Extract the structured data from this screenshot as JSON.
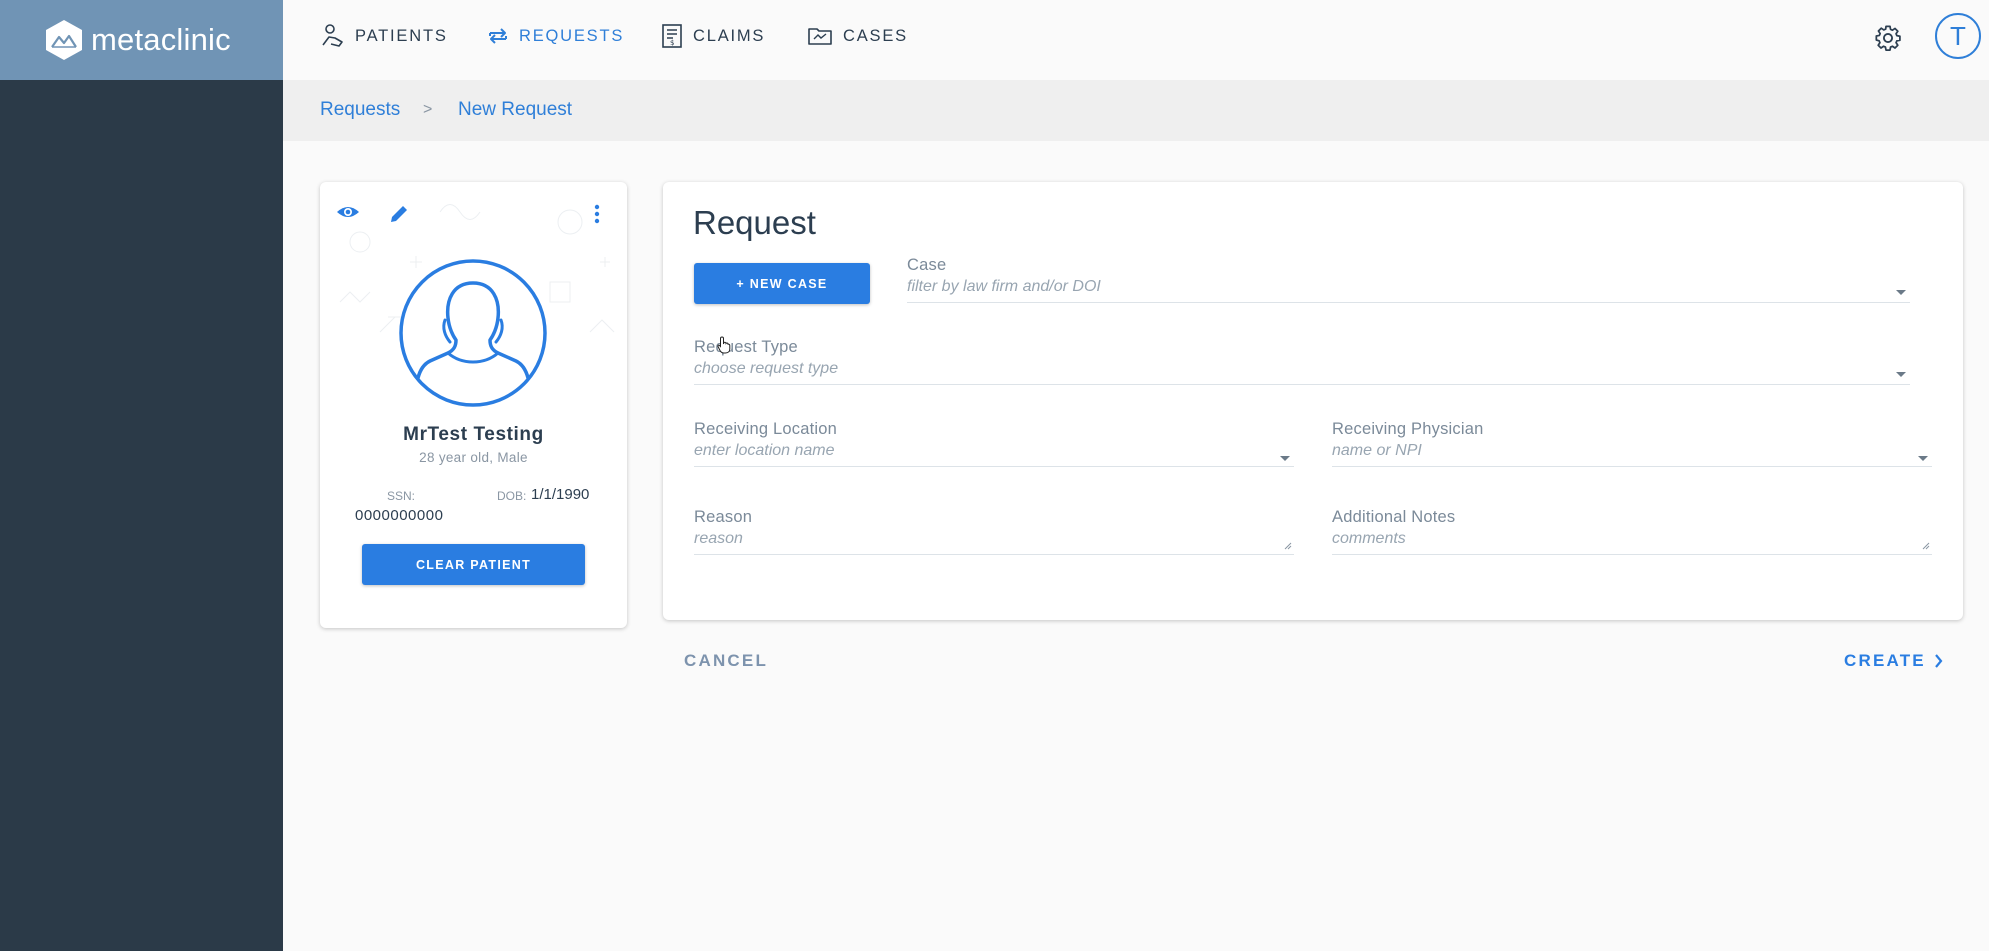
{
  "brand": {
    "name": "metaclinic",
    "icon": "mountain-logo-icon",
    "color": "#7094b5"
  },
  "nav": {
    "items": [
      {
        "label": "PATIENTS",
        "icon": "patient-hand-icon",
        "active": false
      },
      {
        "label": "REQUESTS",
        "icon": "repeat-arrows-icon",
        "active": true
      },
      {
        "label": "CLAIMS",
        "icon": "claim-document-icon",
        "active": false
      },
      {
        "label": "CASES",
        "icon": "folder-case-icon",
        "active": false
      }
    ],
    "settings_icon": "gear-icon",
    "user_initial": "T"
  },
  "breadcrumb": {
    "parent": "Requests",
    "separator": ">",
    "current": "New Request"
  },
  "patient": {
    "name": "MrTest Testing",
    "info": "28 year old, Male",
    "ssn_label": "SSN:",
    "ssn": "0000000000",
    "dob_label": "DOB:",
    "dob": "1/1/1990",
    "clear_button": "CLEAR PATIENT",
    "icons": [
      "eye-icon",
      "pencil-icon",
      "more-vertical-icon",
      "person-avatar-icon"
    ]
  },
  "request": {
    "title": "Request",
    "new_case_button": "+ NEW CASE",
    "case": {
      "label": "Case",
      "placeholder": "filter by law firm and/or DOI"
    },
    "request_type": {
      "label": "Request Type",
      "placeholder": "choose request type"
    },
    "receiving_location": {
      "label": "Receiving Location",
      "placeholder": "enter location name"
    },
    "receiving_physician": {
      "label": "Receiving Physician",
      "placeholder": "name or NPI"
    },
    "reason": {
      "label": "Reason",
      "placeholder": "reason"
    },
    "additional_notes": {
      "label": "Additional Notes",
      "placeholder": "comments"
    }
  },
  "actions": {
    "cancel": "CANCEL",
    "create": "CREATE"
  },
  "colors": {
    "accent": "#2a7de1",
    "sidebar": "#2b3a48",
    "text": "#2c3e50"
  }
}
